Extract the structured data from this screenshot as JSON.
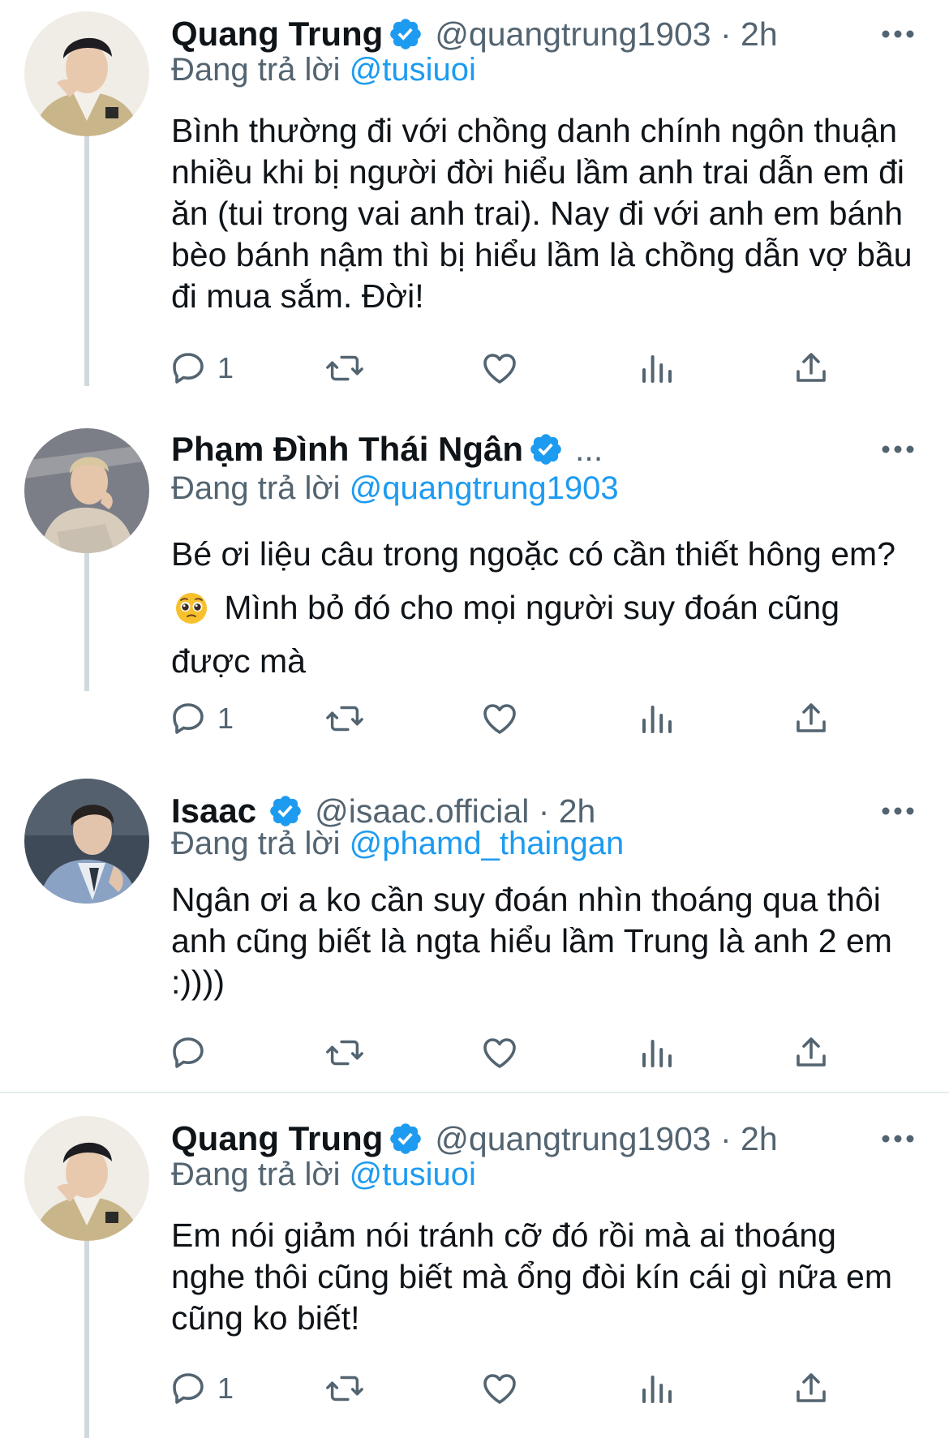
{
  "replying_prefix": "Đang trả lời",
  "tweets": [
    {
      "name": "Quang Trung",
      "handle_time": "@quangtrung1903 · 2h",
      "reply_to": "@tusiuoi",
      "text": "Bình thường đi với chồng danh chính ngôn thuận nhiều khi bị người đời hiểu lầm anh trai dẫn em đi ăn (tui trong vai anh trai). Nay đi với anh em bánh bèo bánh nậm thì bị hiểu lầm là chồng dẫn vợ bầu đi mua sắm. Đời!",
      "reply_count": "1",
      "avatar_palette": {
        "bg": "#f0ede6",
        "jacket": "#c9b58a",
        "skin": "#e9c9ae",
        "hair": "#1d1d22"
      }
    },
    {
      "name": "Phạm Đình Thái Ngân",
      "handle_time": "...",
      "reply_to": "@quangtrung1903",
      "text_before_emoji": "Bé ơi liệu câu trong ngoặc có cần thiết hông em?",
      "emoji_name": "pleading-face-emoji",
      "text_after_emoji": "Mình bỏ đó cho mọi người suy đoán cũng được mà",
      "reply_count": "1",
      "avatar_palette": {
        "bg": "#7b7e86",
        "jacket": "#d8cdbd",
        "skin": "#e5c6ab",
        "hair": "#d9c7a0"
      }
    },
    {
      "name": "Isaac",
      "handle_time": "@isaac.official · 2h",
      "reply_to": "@phamd_thaingan",
      "text": "Ngân ơi a ko cần suy đoán nhìn thoáng qua thôi anh cũng biết là ngta hiểu lầm Trung là anh 2 em :))))",
      "reply_count": "",
      "avatar_palette": {
        "bg": "#3f4a58",
        "jacket": "#8aa2c4",
        "skin": "#e2c4ad",
        "hair": "#26221f"
      }
    },
    {
      "name": "Quang Trung",
      "handle_time": "@quangtrung1903 · 2h",
      "reply_to": "@tusiuoi",
      "text": "Em nói giảm nói tránh cỡ đó rồi mà ai thoáng nghe thôi cũng biết mà ổng đòi kín cái gì nữa em cũng ko biết!",
      "reply_count": "1",
      "avatar_palette": {
        "bg": "#f0ede6",
        "jacket": "#c9b58a",
        "skin": "#e9c9ae",
        "hair": "#1d1d22"
      }
    }
  ],
  "icons": {
    "reply": "speech-bubble-icon",
    "retweet": "retweet-arrows-icon",
    "like": "heart-icon",
    "analytics": "bar-chart-icon",
    "share": "share-upload-icon",
    "more": "three-dots-icon",
    "verified": "verified-badge-icon"
  },
  "colors": {
    "text": "#0f1419",
    "secondary": "#536471",
    "accent": "#1d9bf0",
    "thread_line": "#cfd9de"
  }
}
